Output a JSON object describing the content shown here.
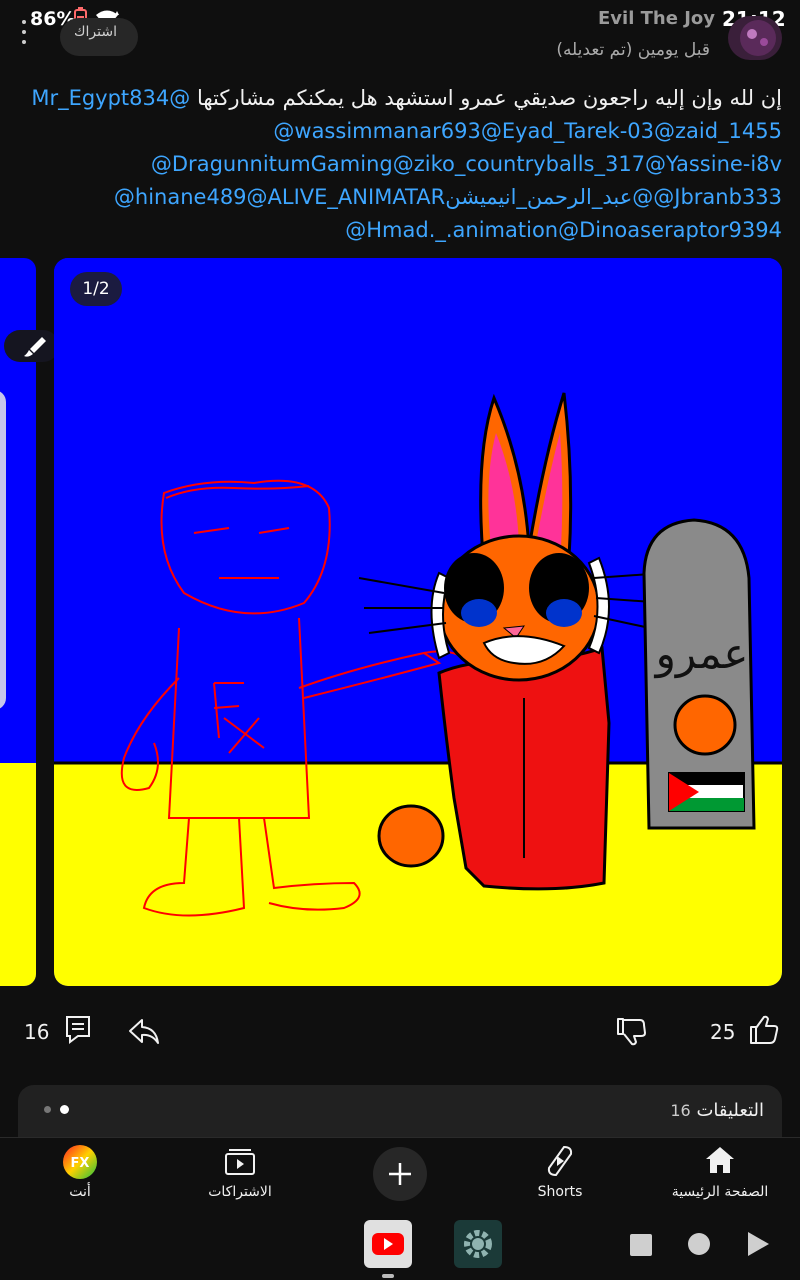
{
  "status_bar": {
    "battery": "86%",
    "username": "Evil The Joy",
    "time": "21:12"
  },
  "post": {
    "subscribe_label": "اشتراك",
    "meta": "قبل يومين (تم تعديله)",
    "text_line1": "إن لله وإن إليه راجعون صديقي عمرو استشهد هل يمكنكم مشاركتها",
    "mentions": {
      "m1": "@Mr_Egypt834",
      "line2": "@wassimmanar693@Eyad_Tarek-03@zaid_1455",
      "line3": "@DragunnitumGaming@ziko_countryballs_317@Yassine-i8v",
      "line4": "@hinane489@ALIVE_ANIMATARعبد_الرحمن_انيميشن@@Jbranb333",
      "line5": "@Hmad._.animation@Dinoaseraptor9394"
    },
    "page_counter": "1/2",
    "tombstone_text": "عمرو"
  },
  "actions": {
    "comments_count": "16",
    "likes_count": "25"
  },
  "comments": {
    "label": "التعليقات",
    "count": "16"
  },
  "bottom_nav": {
    "you": "أنت",
    "subscriptions": "الاشتراكات",
    "shorts": "Shorts",
    "home": "الصفحة الرئيسية"
  },
  "colors": {
    "link": "#3ea6ff",
    "sky": "#0000ff",
    "ground": "#ffff00",
    "accent_red": "#ff0000"
  }
}
